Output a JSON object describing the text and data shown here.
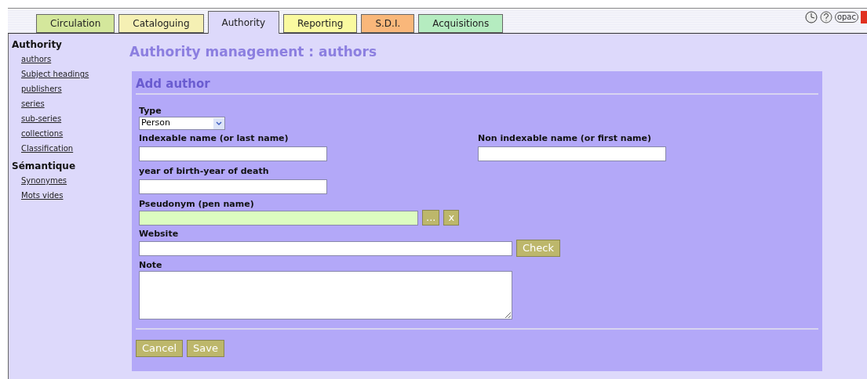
{
  "tabs": [
    {
      "label": "Circulation",
      "selected": false,
      "color": "#d4e79c"
    },
    {
      "label": "Cataloguing",
      "selected": false,
      "color": "#f5f0b4"
    },
    {
      "label": "Authority",
      "selected": true,
      "color": "#ddd9fb"
    },
    {
      "label": "Reporting",
      "selected": false,
      "color": "#fafaa0"
    },
    {
      "label": "S.D.I.",
      "selected": false,
      "color": "#f9b77a"
    },
    {
      "label": "Acquisitions",
      "selected": false,
      "color": "#b5ecc0"
    }
  ],
  "header_icons": {
    "opac_label": "opac"
  },
  "sidebar": [
    {
      "heading": "Authority",
      "items": [
        "authors",
        "Subject headings",
        "publishers",
        "series",
        "sub-series",
        "collections",
        "Classification"
      ]
    },
    {
      "heading": "Sémantique",
      "items": [
        "Synonymes",
        "Mots vides"
      ]
    }
  ],
  "page_title": "Authority management : authors",
  "form": {
    "title": "Add author",
    "type": {
      "label": "Type",
      "value": "Person"
    },
    "indexable_name": {
      "label": "Indexable name (or last name)"
    },
    "non_indexable_name": {
      "label": "Non indexable name (or first name)"
    },
    "years": {
      "label": "year of birth-year of death"
    },
    "pseudonym": {
      "label": "Pseudonym (pen name)",
      "select_button": "...",
      "clear_button": "x"
    },
    "website": {
      "label": "Website",
      "check_button": "Check"
    },
    "note": {
      "label": "Note"
    },
    "buttons": [
      "Cancel",
      "Save"
    ]
  }
}
